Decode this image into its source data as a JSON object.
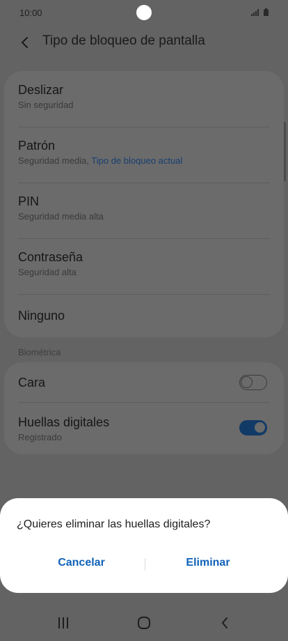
{
  "status_bar": {
    "time": "10:00",
    "icons": [
      "signal-icon",
      "battery-icon"
    ]
  },
  "header": {
    "back_icon": "back-arrow-icon",
    "title": "Tipo de bloqueo de pantalla"
  },
  "lock_types": [
    {
      "title": "Deslizar",
      "subtitle": "Sin seguridad"
    },
    {
      "title": "Patrón",
      "subtitle": "Seguridad media, ",
      "subtitle_highlight": "Tipo de bloqueo actual"
    },
    {
      "title": "PIN",
      "subtitle": "Seguridad media alta"
    },
    {
      "title": "Contraseña",
      "subtitle": "Seguridad alta"
    },
    {
      "title": "Ninguno"
    }
  ],
  "biometrics": {
    "section_label": "Biométrica",
    "items": [
      {
        "title": "Cara",
        "enabled": false
      },
      {
        "title": "Huellas digitales",
        "subtitle": "Registrado",
        "enabled": true
      }
    ]
  },
  "dialog": {
    "message": "¿Quieres eliminar las huellas digitales?",
    "cancel_label": "Cancelar",
    "confirm_label": "Eliminar"
  },
  "navbar": {
    "icons": [
      "recent-apps-icon",
      "home-icon",
      "back-icon"
    ]
  },
  "colors": {
    "dim_background": "#636363",
    "card": "#6b6b6b",
    "accent": "#1162b8",
    "dialog_background": "#ffffff"
  }
}
